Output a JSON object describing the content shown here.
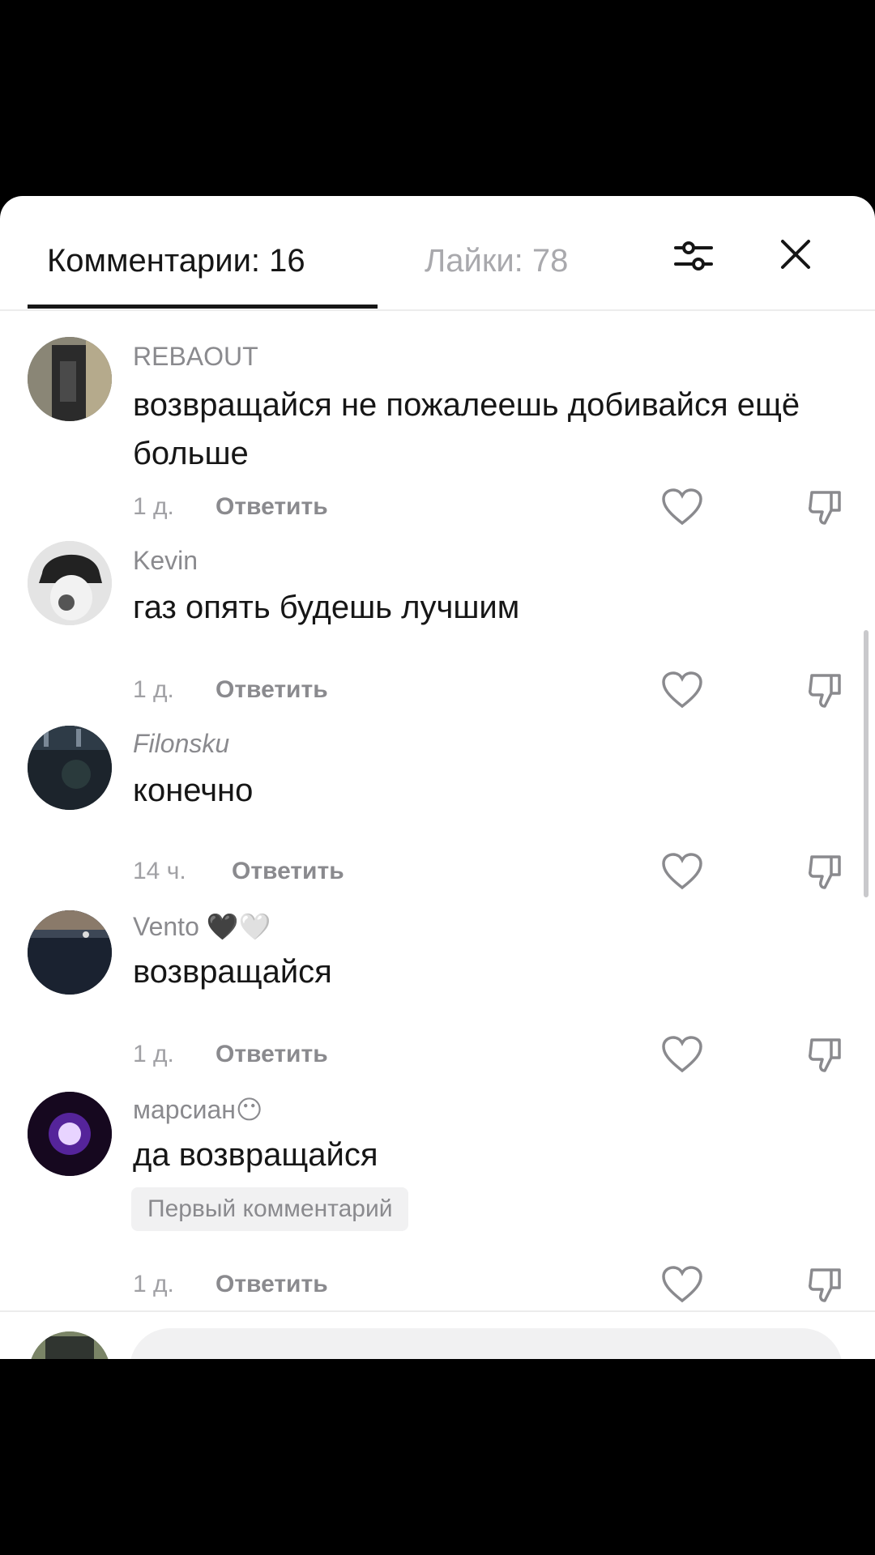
{
  "header": {
    "comments_tab": "Комментарии: 16",
    "likes_tab": "Лайки: 78",
    "filter_icon": "sliders-icon",
    "close_icon": "close-icon"
  },
  "comments": [
    {
      "username": "REBAOUT",
      "text": "возвращайся не пожалеешь добивайся ещё больше",
      "time": "1 д.",
      "reply": "Ответить",
      "avatar_color": "#6b6f6a"
    },
    {
      "username": "Kevin",
      "text": "газ опять будешь лучшим",
      "time": "1 д.",
      "reply": "Ответить",
      "avatar_color": "#d9d9d9"
    },
    {
      "username": "Filonsku",
      "text": "конечно",
      "time": "14 ч.",
      "reply": "Ответить",
      "avatar_color": "#1f2a33"
    },
    {
      "username": "Vento 🖤🤍",
      "text": "возвращайся",
      "time": "1 д.",
      "reply": "Ответить",
      "avatar_color": "#1a2230"
    },
    {
      "username": "марсиан😶",
      "text": "да возвращайся",
      "badge": "Первый комментарий",
      "time": "1 д.",
      "reply": "Ответить",
      "avatar_color": "#2a0d44"
    }
  ],
  "colors": {
    "primary_text": "#161616",
    "secondary_text": "#8a8a8e",
    "background": "#ffffff"
  }
}
